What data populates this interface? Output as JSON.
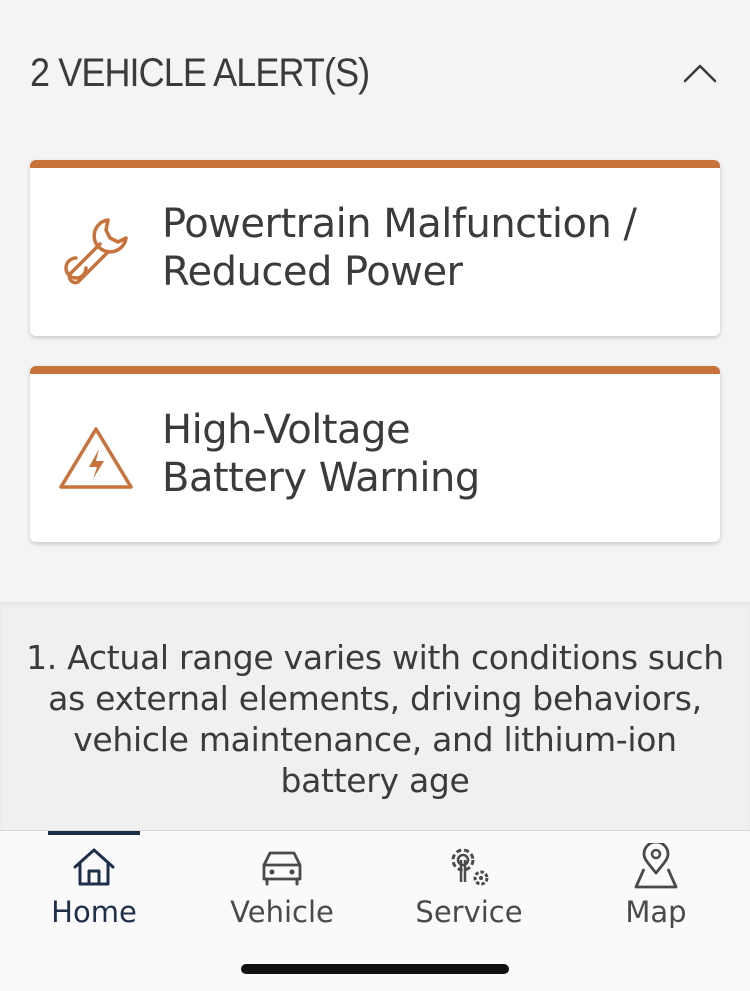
{
  "alerts": {
    "title": "2 VEHICLE ALERT(S)",
    "items": [
      {
        "line1": "Powertrain Malfunction /",
        "line2": "Reduced Power",
        "icon": "wrench-icon"
      },
      {
        "line1": "High-Voltage",
        "line2": "Battery Warning",
        "icon": "high-voltage-warning-icon"
      }
    ]
  },
  "footnote": {
    "text": "1. Actual range varies with conditions such as external elements, driving behaviors, vehicle maintenance, and lithium-ion battery age"
  },
  "nav": {
    "items": [
      {
        "label": "Home",
        "icon": "home-icon",
        "active": true
      },
      {
        "label": "Vehicle",
        "icon": "car-icon",
        "active": false
      },
      {
        "label": "Service",
        "icon": "service-gears-icon",
        "active": false
      },
      {
        "label": "Map",
        "icon": "map-pin-icon",
        "active": false
      }
    ]
  },
  "colors": {
    "accent": "#c8733c",
    "nav_active": "#1e2f4a",
    "text": "#3b3b3b"
  }
}
